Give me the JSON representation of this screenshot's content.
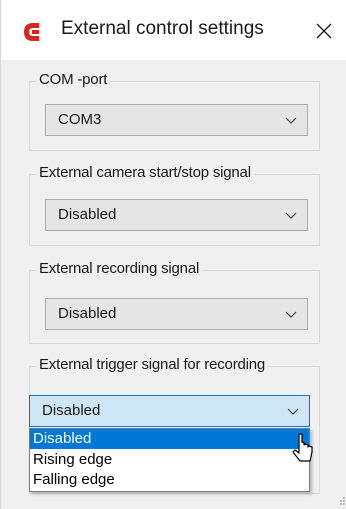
{
  "window": {
    "title": "External control settings",
    "app_icon": "app-logo-icon",
    "close_icon": "close-icon"
  },
  "groups": [
    {
      "legend": "COM -port",
      "selected": "COM3"
    },
    {
      "legend": "External camera start/stop signal",
      "selected": "Disabled"
    },
    {
      "legend": "External recording signal",
      "selected": "Disabled"
    },
    {
      "legend": "External trigger signal for recording",
      "selected": "Disabled"
    }
  ],
  "dropdown": {
    "options": [
      "Disabled",
      "Rising edge",
      "Falling edge"
    ],
    "highlighted": "Disabled"
  },
  "colors": {
    "accent": "#0078d7",
    "logo_red": "#d42a1e",
    "window_bg": "#f0f0f0",
    "combo_bg": "#e5e5e5",
    "combo_active_bg": "#cfe6f7"
  }
}
